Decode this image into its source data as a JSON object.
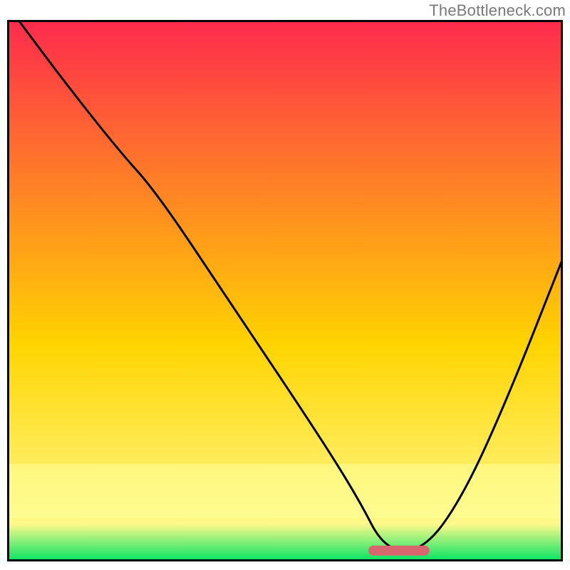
{
  "watermark": "TheBottleneck.com",
  "chart_data": {
    "type": "line",
    "title": "",
    "xlabel": "",
    "ylabel": "",
    "xlim": [
      0,
      100
    ],
    "ylim": [
      0,
      100
    ],
    "background_gradient": {
      "top": "#ff2a4d",
      "mid": "#ffd400",
      "bottom": "#00e463"
    },
    "curve": {
      "description": "V-shaped bottleneck curve with minimum near x≈70",
      "x": [
        2,
        10,
        20,
        27,
        40,
        55,
        63,
        68,
        75,
        82,
        90,
        100
      ],
      "y": [
        100,
        89,
        76,
        68,
        48,
        25,
        12,
        2,
        2,
        12,
        30,
        56
      ]
    },
    "optimal_marker": {
      "description": "Rounded bar marking optimal region",
      "x_start": 65,
      "x_end": 76,
      "y": 2,
      "color": "#d9656f"
    },
    "frame_color": "#000000"
  }
}
